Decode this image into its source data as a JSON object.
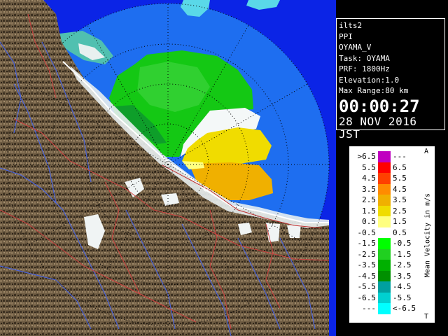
{
  "info": {
    "radar": "ilts2",
    "mode": "PPI",
    "station": "OYAMA_V",
    "task": "Task: OYAMA",
    "prf": "PRF: 1800Hz",
    "elevation": "Elevation:1.0",
    "max_range": "Max Range:80 km",
    "time": "00:00:27",
    "date": "28 NOV 2016 JST"
  },
  "legend": {
    "title": "Mean Velocity in m/s",
    "top_marker": "A",
    "bottom_marker": "T",
    "rows": [
      {
        "lo": ">6.5",
        "hi": "---",
        "color": "#c000c0"
      },
      {
        "lo": "5.5",
        "hi": "6.5",
        "color": "#ff0000"
      },
      {
        "lo": "4.5",
        "hi": "5.5",
        "color": "#ff4000"
      },
      {
        "lo": "3.5",
        "hi": "4.5",
        "color": "#ff8c00"
      },
      {
        "lo": "2.5",
        "hi": "3.5",
        "color": "#f0b000"
      },
      {
        "lo": "1.5",
        "hi": "2.5",
        "color": "#f0dc00"
      },
      {
        "lo": "0.5",
        "hi": "1.5",
        "color": "#ffff80"
      },
      {
        "lo": "-0.5",
        "hi": "0.5",
        "color": "#ffffff"
      },
      {
        "lo": "-1.5",
        "hi": "-0.5",
        "color": "#00ff00"
      },
      {
        "lo": "-2.5",
        "hi": "-1.5",
        "color": "#20d020"
      },
      {
        "lo": "-3.5",
        "hi": "-2.5",
        "color": "#00b000"
      },
      {
        "lo": "-4.5",
        "hi": "-3.5",
        "color": "#009000"
      },
      {
        "lo": "-5.5",
        "hi": "-4.5",
        "color": "#00a0a0"
      },
      {
        "lo": "-6.5",
        "hi": "-5.5",
        "color": "#00d0d0"
      },
      {
        "lo": "---",
        "hi": "<-6.5",
        "color": "#00ffff"
      }
    ]
  },
  "colors": {
    "background": "#000000",
    "sea": "#0b24e6",
    "range_disc": "#1e6ef0",
    "land": "#6b5a40",
    "rivers": "#4a63d8",
    "boundaries": "#d04040",
    "grid": "#000000"
  }
}
